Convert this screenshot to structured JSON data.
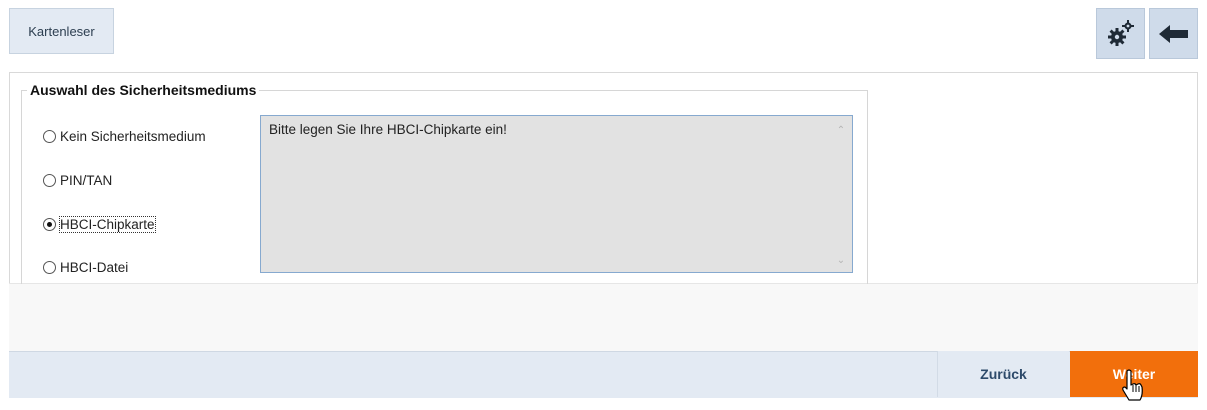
{
  "toolbar": {
    "card_reader_label": "Kartenleser",
    "settings_icon": "gears-icon",
    "back_icon": "arrow-left-icon",
    "accent": "#cfdbea"
  },
  "security_medium": {
    "group_title": "Auswahl des Sicherheitsmediums",
    "options": [
      {
        "label": "Kein Sicherheitsmedium",
        "checked": false
      },
      {
        "label": "PIN/TAN",
        "checked": false
      },
      {
        "label": "HBCI-Chipkarte",
        "checked": true
      },
      {
        "label": "HBCI-Datei",
        "checked": false
      }
    ],
    "message": "Bitte legen Sie Ihre HBCI-Chipkarte ein!"
  },
  "footer": {
    "back_label": "Zurück",
    "next_label": "Weiter",
    "next_color": "#f26f0c"
  }
}
